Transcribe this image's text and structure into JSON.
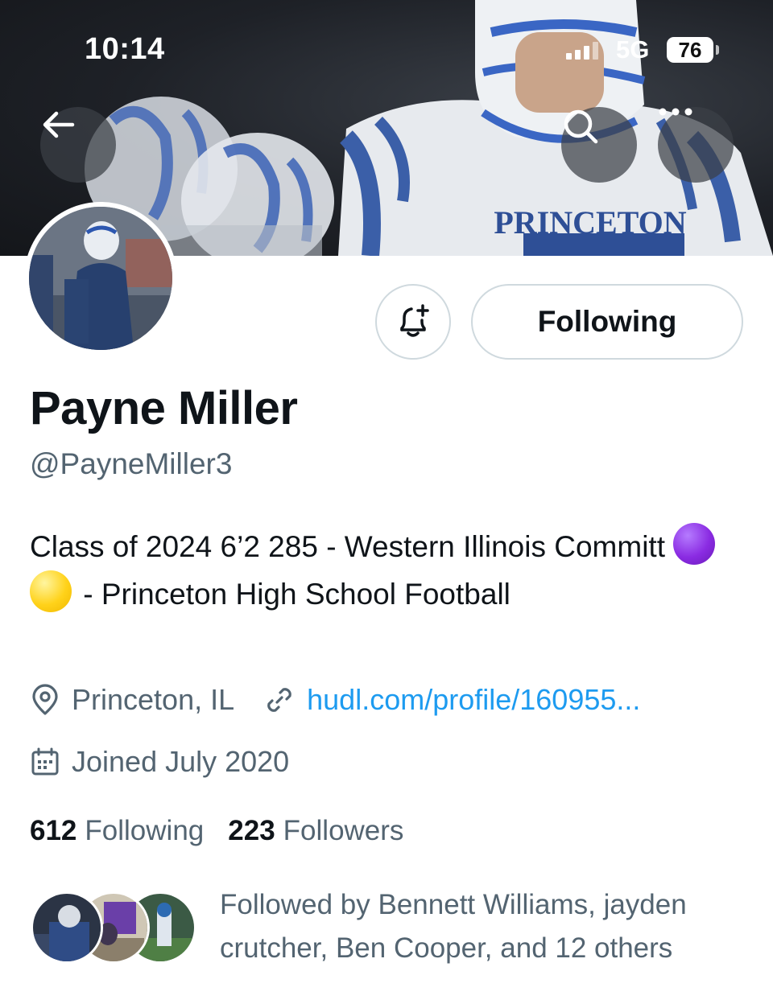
{
  "status_bar": {
    "time": "10:14",
    "network": "5G",
    "battery": "76"
  },
  "banner": {
    "jersey_text": "PRINCETON"
  },
  "profile": {
    "name": "Payne Miller",
    "handle": "@PayneMiller3",
    "bio_part1": "Class of 2024 6’2 285 - Western Illinois Committ",
    "bio_part2": " - Princeton High School Football",
    "location": "Princeton, IL",
    "link": "hudl.com/profile/160955...",
    "joined": "Joined July 2020"
  },
  "actions": {
    "follow_label": "Following"
  },
  "stats": {
    "following_count": "612",
    "following_label": "Following",
    "followers_count": "223",
    "followers_label": "Followers"
  },
  "followed_by": "Followed by Bennett Williams, jayden crutcher, Ben Cooper, and 12 others",
  "icons": {
    "back": "arrow-left-icon",
    "search": "search-icon",
    "more": "more-icon",
    "notify": "bell-plus-icon",
    "location": "location-pin-icon",
    "link": "link-icon",
    "calendar": "calendar-icon"
  },
  "colors": {
    "link": "#1d9bf0",
    "secondary_text": "#536471",
    "primary_text": "#0f1419",
    "border": "#cfd9de"
  }
}
